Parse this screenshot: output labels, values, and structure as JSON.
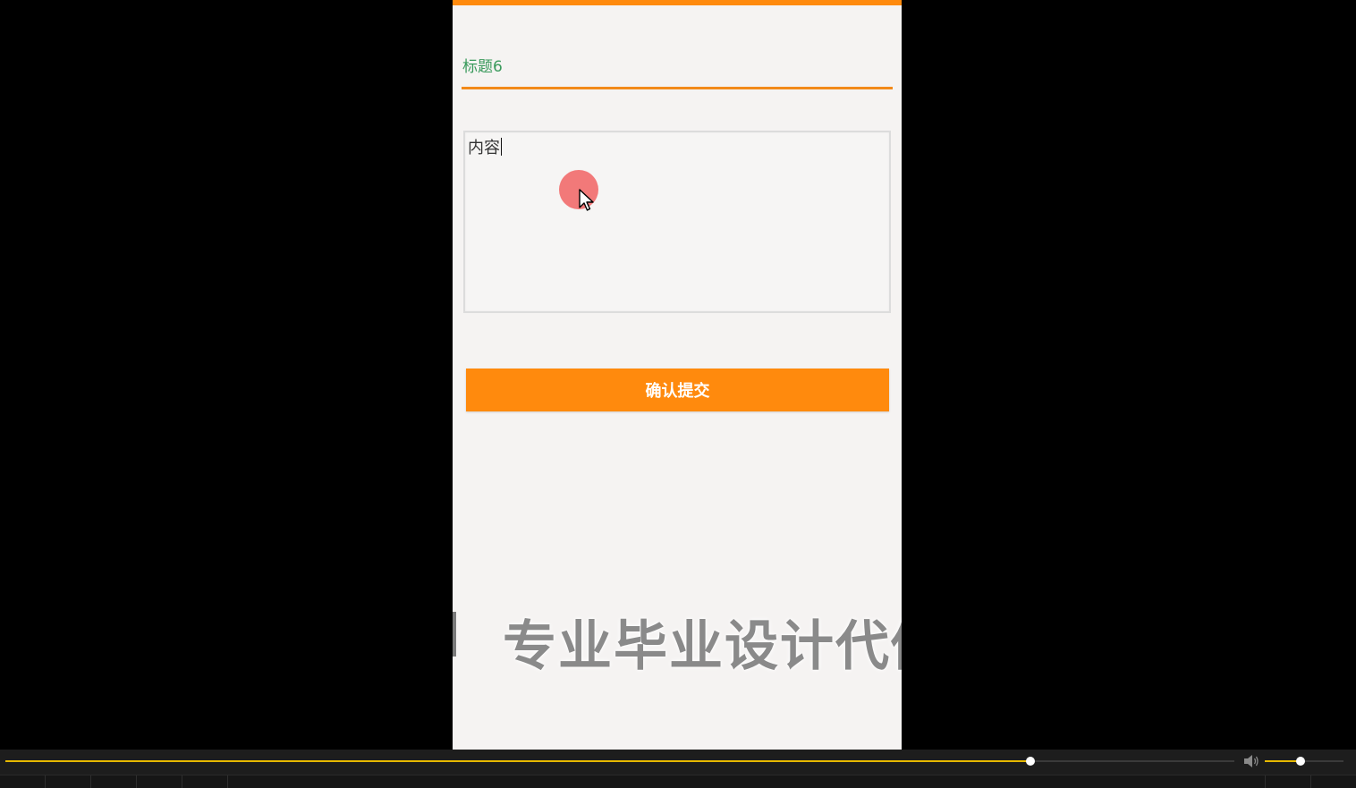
{
  "form": {
    "title_value": "标题6",
    "content_value": "内容",
    "submit_label": "确认提交"
  },
  "watermark": {
    "text": "专业毕业设计代做"
  },
  "player": {
    "progress_fraction": 0.834,
    "volume_fraction": 0.45
  },
  "colors": {
    "accent": "#ff8a0d",
    "title_text": "#3a9a5c",
    "progress": "#e6b800"
  },
  "icons": {
    "cursor": "mouse-pointer-icon",
    "volume": "speaker-icon"
  }
}
